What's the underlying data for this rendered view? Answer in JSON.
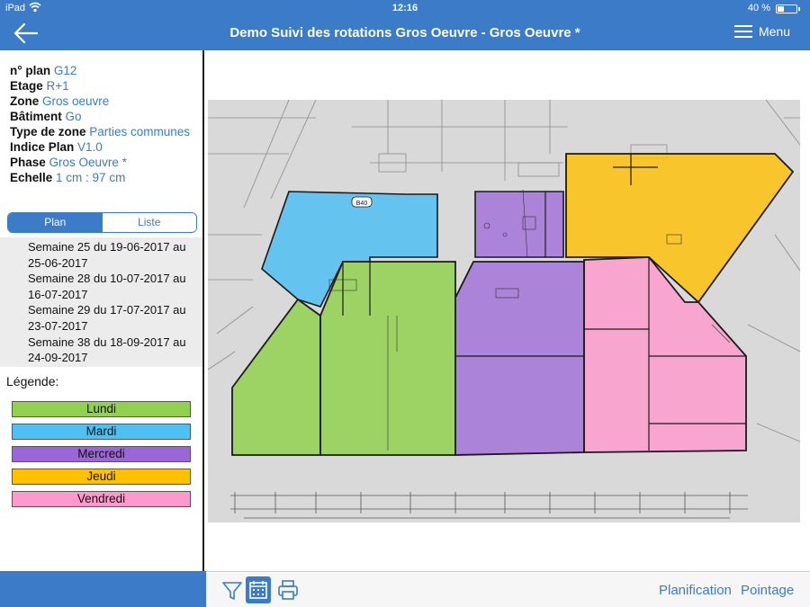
{
  "status_bar": {
    "carrier": "iPad",
    "time": "12:16",
    "battery": "40 %"
  },
  "header": {
    "title": "Demo Suivi des rotations Gros Oeuvre - Gros Oeuvre *",
    "menu_label": "Menu",
    "back_icon": "arrow-left-icon",
    "menu_icon": "hamburger-icon"
  },
  "info": {
    "plan_label": "n° plan",
    "plan_value": "G12",
    "etage_label": "Etage",
    "etage_value": "R+1",
    "zone_label": "Zone",
    "zone_value": "Gros oeuvre",
    "batiment_label": "Bâtiment",
    "batiment_value": "Go",
    "type_label": "Type de zone",
    "type_value": "Parties communes",
    "indice_label": "Indice Plan",
    "indice_value": "V1.0",
    "phase_label": "Phase",
    "phase_value": "Gros Oeuvre *",
    "echelle_label": "Echelle",
    "echelle_value": "1 cm : 97 cm"
  },
  "segmented": {
    "plan": "Plan",
    "liste": "Liste",
    "selected": "Plan"
  },
  "weeks": [
    "Semaine 25 du 19-06-2017 au 25-06-2017",
    "Semaine 28 du 10-07-2017 au 16-07-2017",
    "Semaine 29 du 17-07-2017 au 23-07-2017",
    "Semaine 38 du 18-09-2017 au 24-09-2017"
  ],
  "legend": {
    "title": "Légende:",
    "items": [
      {
        "label": "Lundi",
        "color": "#92d050"
      },
      {
        "label": "Mardi",
        "color": "#4fc0f2"
      },
      {
        "label": "Mercredi",
        "color": "#9b66d8"
      },
      {
        "label": "Jeudi",
        "color": "#ffc000"
      },
      {
        "label": "Vendredi",
        "color": "#ff99cc"
      }
    ]
  },
  "plan": {
    "room_label": "B40"
  },
  "bottom_bar": {
    "planification": "Planification",
    "pointage": "Pointage",
    "tools": [
      "filter-icon",
      "calendar-icon",
      "printer-icon"
    ]
  },
  "colors": {
    "primary": "#3b7bc8",
    "plan_background": "#d9d9d9"
  }
}
